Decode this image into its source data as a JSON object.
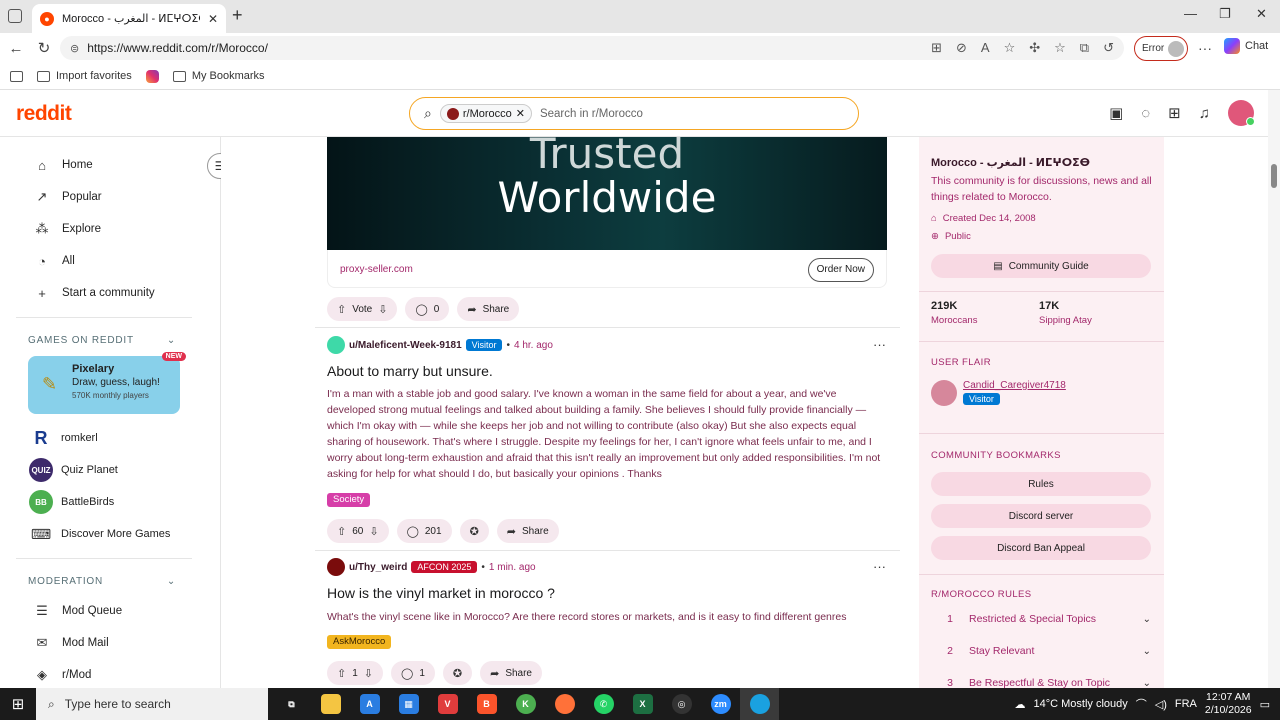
{
  "browser": {
    "tab_title": "Morocco - المغرب - ⵍⵎⵖⵔⵉⴱ",
    "url": "https://www.reddit.com/r/Morocco/",
    "error_label": "Error",
    "chat_label": "Chat",
    "bookmarks": [
      "Import favorites",
      "My Bookmarks"
    ]
  },
  "header": {
    "logo": "reddit",
    "search_chip": "r/Morocco",
    "search_placeholder": "Search in r/Morocco"
  },
  "leftnav": {
    "items": [
      "Home",
      "Popular",
      "Explore",
      "All",
      "Start a community"
    ],
    "games_header": "GAMES ON REDDIT",
    "featured_game": {
      "title": "Pixelary",
      "subtitle": "Draw, guess, laugh!",
      "players": "570K monthly players",
      "badge": "NEW"
    },
    "games": [
      {
        "name": "romkerl",
        "icon_text": "R",
        "color": "#1a3c8f"
      },
      {
        "name": "Quiz Planet",
        "icon_text": "QUIZ",
        "color": "#3d2a6b"
      },
      {
        "name": "BattleBirds",
        "icon_text": "BB",
        "color": "#4caf50"
      },
      {
        "name": "Discover More Games",
        "icon_text": "",
        "color": ""
      }
    ],
    "moderation_header": "MODERATION",
    "moderation_items": [
      "Mod Queue",
      "Mod Mail",
      "r/Mod"
    ]
  },
  "feed": {
    "ad": {
      "line1": "Trusted",
      "line2": "Worldwide",
      "domain": "proxy-seller.com",
      "cta": "Order Now",
      "vote": "Vote",
      "comments": "0",
      "share": "Share"
    },
    "posts": [
      {
        "user": "u/Maleficent-Week-9181",
        "flair": "Visitor",
        "time": "4 hr. ago",
        "title": "About to marry but unsure.",
        "body": "I'm a man with a stable job and good salary. I've known a woman in the same field for about a year, and we've developed strong mutual feelings and talked about building a family. She believes I should fully provide financially — which I'm okay with — while she keeps her job and not willing to contribute (also okay) But she also expects equal sharing of housework. That's where I struggle. Despite my feelings for her, I can't ignore what feels unfair to me, and I worry about long-term exhaustion and afraid that this isn't really an improvement but only added responsibilities. I'm not asking for help for what should I do, but basically your opinions . Thanks",
        "tag": "Society",
        "votes": "60",
        "comments": "201",
        "share": "Share"
      },
      {
        "user": "u/Thy_weird",
        "flair": "AFCON 2025",
        "time": "1 min. ago",
        "title": "How is the vinyl market in morocco ?",
        "body": "What's the vinyl scene like in Morocco? Are there record stores or markets, and is it easy to find different genres",
        "tag": "AskMorocco",
        "votes": "1",
        "comments": "1",
        "share": "Share"
      }
    ]
  },
  "sidebar": {
    "name": "Morocco - المغرب - ⵍⵎⵖⵔⵉⴱ",
    "description": "This community is for discussions, news and all things related to Morocco.",
    "created": "Created Dec 14, 2008",
    "visibility": "Public",
    "guide_button": "Community Guide",
    "members_count": "219K",
    "members_label": "Moroccans",
    "online_count": "17K",
    "online_label": "Sipping Atay",
    "user_flair_header": "USER FLAIR",
    "user_name": "Candid_Caregiver4718",
    "user_flair": "Visitor",
    "bookmarks_header": "COMMUNITY BOOKMARKS",
    "bookmarks": [
      "Rules",
      "Discord server",
      "Discord Ban Appeal"
    ],
    "rules_header": "R/MOROCCO RULES",
    "rules": [
      {
        "num": "1",
        "text": "Restricted & Special Topics"
      },
      {
        "num": "2",
        "text": "Stay Relevant"
      },
      {
        "num": "3",
        "text": "Be Respectful & Stay on Topic"
      }
    ]
  },
  "taskbar": {
    "search_placeholder": "Type here to search",
    "weather": "14°C  Mostly cloudy",
    "lang": "FRA",
    "time": "12:07 AM",
    "date": "2/10/2026"
  }
}
